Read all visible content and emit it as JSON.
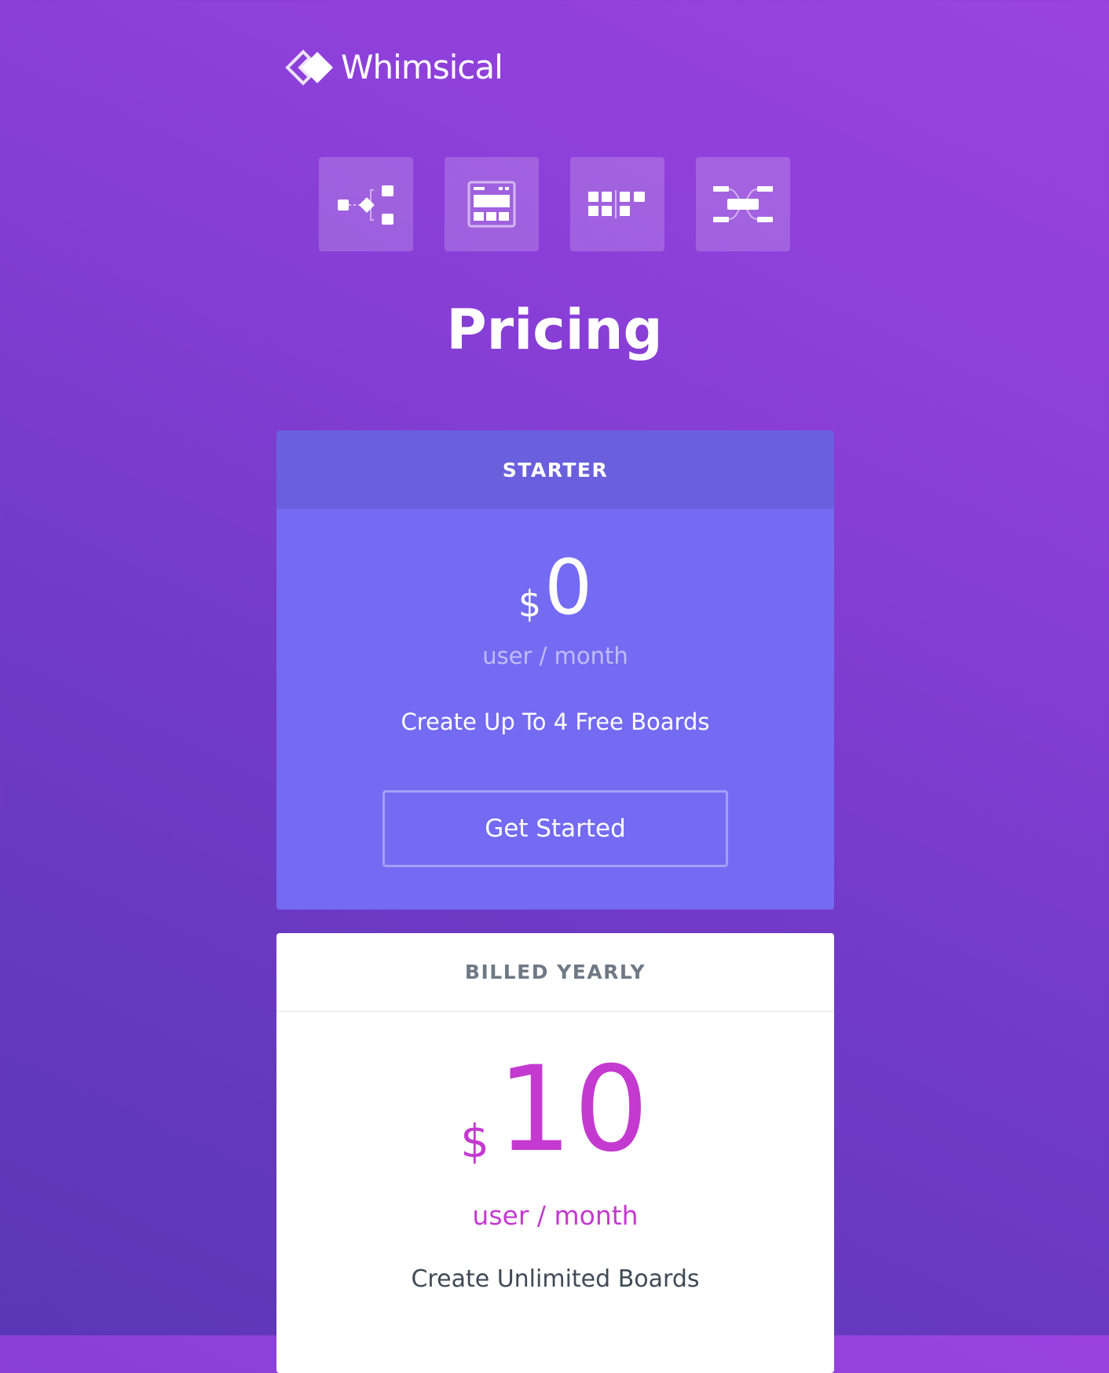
{
  "brand": {
    "name": "Whimsical"
  },
  "products": [
    {
      "icon": "flowchart-icon"
    },
    {
      "icon": "wireframe-icon"
    },
    {
      "icon": "board-grid-icon"
    },
    {
      "icon": "mindmap-icon"
    }
  ],
  "page": {
    "title": "Pricing"
  },
  "plans": {
    "starter": {
      "header": "STARTER",
      "currency": "$",
      "amount": "0",
      "unit": "user / month",
      "description": "Create Up To 4 Free Boards",
      "cta": "Get Started"
    },
    "yearly": {
      "header": "BILLED YEARLY",
      "currency": "$",
      "amount": "10",
      "unit": "user / month",
      "description": "Create Unlimited Boards"
    }
  },
  "colors": {
    "background_top": "#9a42e0",
    "background_bottom": "#5a37b4",
    "starter_card": "#746bf2",
    "starter_header": "#6a60dd",
    "accent_price": "#c43ad0",
    "muted_text": "#6e7985"
  }
}
